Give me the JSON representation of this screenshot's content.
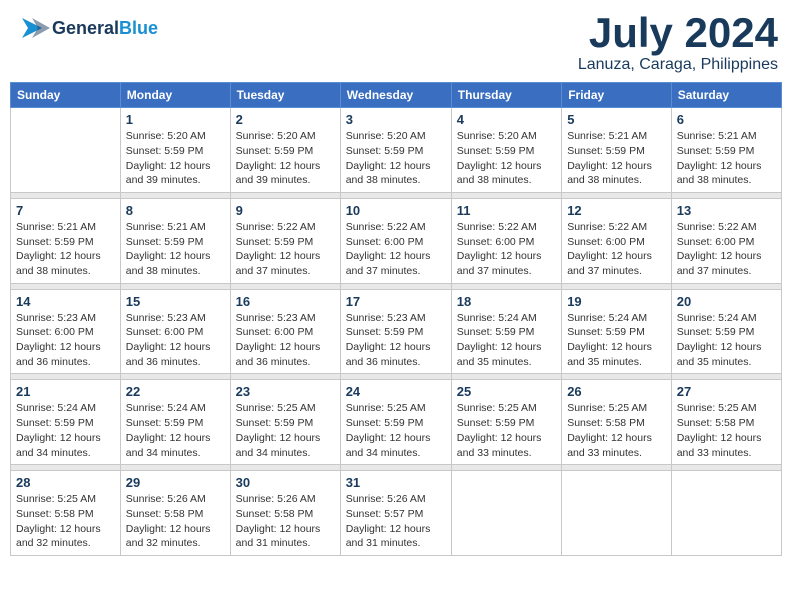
{
  "header": {
    "logo_general": "General",
    "logo_blue": "Blue",
    "month": "July 2024",
    "location": "Lanuza, Caraga, Philippines"
  },
  "days_of_week": [
    "Sunday",
    "Monday",
    "Tuesday",
    "Wednesday",
    "Thursday",
    "Friday",
    "Saturday"
  ],
  "weeks": [
    {
      "days": [
        {
          "num": "",
          "sunrise": "",
          "sunset": "",
          "daylight": ""
        },
        {
          "num": "1",
          "sunrise": "Sunrise: 5:20 AM",
          "sunset": "Sunset: 5:59 PM",
          "daylight": "Daylight: 12 hours and 39 minutes."
        },
        {
          "num": "2",
          "sunrise": "Sunrise: 5:20 AM",
          "sunset": "Sunset: 5:59 PM",
          "daylight": "Daylight: 12 hours and 39 minutes."
        },
        {
          "num": "3",
          "sunrise": "Sunrise: 5:20 AM",
          "sunset": "Sunset: 5:59 PM",
          "daylight": "Daylight: 12 hours and 38 minutes."
        },
        {
          "num": "4",
          "sunrise": "Sunrise: 5:20 AM",
          "sunset": "Sunset: 5:59 PM",
          "daylight": "Daylight: 12 hours and 38 minutes."
        },
        {
          "num": "5",
          "sunrise": "Sunrise: 5:21 AM",
          "sunset": "Sunset: 5:59 PM",
          "daylight": "Daylight: 12 hours and 38 minutes."
        },
        {
          "num": "6",
          "sunrise": "Sunrise: 5:21 AM",
          "sunset": "Sunset: 5:59 PM",
          "daylight": "Daylight: 12 hours and 38 minutes."
        }
      ]
    },
    {
      "days": [
        {
          "num": "7",
          "sunrise": "Sunrise: 5:21 AM",
          "sunset": "Sunset: 5:59 PM",
          "daylight": "Daylight: 12 hours and 38 minutes."
        },
        {
          "num": "8",
          "sunrise": "Sunrise: 5:21 AM",
          "sunset": "Sunset: 5:59 PM",
          "daylight": "Daylight: 12 hours and 38 minutes."
        },
        {
          "num": "9",
          "sunrise": "Sunrise: 5:22 AM",
          "sunset": "Sunset: 5:59 PM",
          "daylight": "Daylight: 12 hours and 37 minutes."
        },
        {
          "num": "10",
          "sunrise": "Sunrise: 5:22 AM",
          "sunset": "Sunset: 6:00 PM",
          "daylight": "Daylight: 12 hours and 37 minutes."
        },
        {
          "num": "11",
          "sunrise": "Sunrise: 5:22 AM",
          "sunset": "Sunset: 6:00 PM",
          "daylight": "Daylight: 12 hours and 37 minutes."
        },
        {
          "num": "12",
          "sunrise": "Sunrise: 5:22 AM",
          "sunset": "Sunset: 6:00 PM",
          "daylight": "Daylight: 12 hours and 37 minutes."
        },
        {
          "num": "13",
          "sunrise": "Sunrise: 5:22 AM",
          "sunset": "Sunset: 6:00 PM",
          "daylight": "Daylight: 12 hours and 37 minutes."
        }
      ]
    },
    {
      "days": [
        {
          "num": "14",
          "sunrise": "Sunrise: 5:23 AM",
          "sunset": "Sunset: 6:00 PM",
          "daylight": "Daylight: 12 hours and 36 minutes."
        },
        {
          "num": "15",
          "sunrise": "Sunrise: 5:23 AM",
          "sunset": "Sunset: 6:00 PM",
          "daylight": "Daylight: 12 hours and 36 minutes."
        },
        {
          "num": "16",
          "sunrise": "Sunrise: 5:23 AM",
          "sunset": "Sunset: 6:00 PM",
          "daylight": "Daylight: 12 hours and 36 minutes."
        },
        {
          "num": "17",
          "sunrise": "Sunrise: 5:23 AM",
          "sunset": "Sunset: 5:59 PM",
          "daylight": "Daylight: 12 hours and 36 minutes."
        },
        {
          "num": "18",
          "sunrise": "Sunrise: 5:24 AM",
          "sunset": "Sunset: 5:59 PM",
          "daylight": "Daylight: 12 hours and 35 minutes."
        },
        {
          "num": "19",
          "sunrise": "Sunrise: 5:24 AM",
          "sunset": "Sunset: 5:59 PM",
          "daylight": "Daylight: 12 hours and 35 minutes."
        },
        {
          "num": "20",
          "sunrise": "Sunrise: 5:24 AM",
          "sunset": "Sunset: 5:59 PM",
          "daylight": "Daylight: 12 hours and 35 minutes."
        }
      ]
    },
    {
      "days": [
        {
          "num": "21",
          "sunrise": "Sunrise: 5:24 AM",
          "sunset": "Sunset: 5:59 PM",
          "daylight": "Daylight: 12 hours and 34 minutes."
        },
        {
          "num": "22",
          "sunrise": "Sunrise: 5:24 AM",
          "sunset": "Sunset: 5:59 PM",
          "daylight": "Daylight: 12 hours and 34 minutes."
        },
        {
          "num": "23",
          "sunrise": "Sunrise: 5:25 AM",
          "sunset": "Sunset: 5:59 PM",
          "daylight": "Daylight: 12 hours and 34 minutes."
        },
        {
          "num": "24",
          "sunrise": "Sunrise: 5:25 AM",
          "sunset": "Sunset: 5:59 PM",
          "daylight": "Daylight: 12 hours and 34 minutes."
        },
        {
          "num": "25",
          "sunrise": "Sunrise: 5:25 AM",
          "sunset": "Sunset: 5:59 PM",
          "daylight": "Daylight: 12 hours and 33 minutes."
        },
        {
          "num": "26",
          "sunrise": "Sunrise: 5:25 AM",
          "sunset": "Sunset: 5:58 PM",
          "daylight": "Daylight: 12 hours and 33 minutes."
        },
        {
          "num": "27",
          "sunrise": "Sunrise: 5:25 AM",
          "sunset": "Sunset: 5:58 PM",
          "daylight": "Daylight: 12 hours and 33 minutes."
        }
      ]
    },
    {
      "days": [
        {
          "num": "28",
          "sunrise": "Sunrise: 5:25 AM",
          "sunset": "Sunset: 5:58 PM",
          "daylight": "Daylight: 12 hours and 32 minutes."
        },
        {
          "num": "29",
          "sunrise": "Sunrise: 5:26 AM",
          "sunset": "Sunset: 5:58 PM",
          "daylight": "Daylight: 12 hours and 32 minutes."
        },
        {
          "num": "30",
          "sunrise": "Sunrise: 5:26 AM",
          "sunset": "Sunset: 5:58 PM",
          "daylight": "Daylight: 12 hours and 31 minutes."
        },
        {
          "num": "31",
          "sunrise": "Sunrise: 5:26 AM",
          "sunset": "Sunset: 5:57 PM",
          "daylight": "Daylight: 12 hours and 31 minutes."
        },
        {
          "num": "",
          "sunrise": "",
          "sunset": "",
          "daylight": ""
        },
        {
          "num": "",
          "sunrise": "",
          "sunset": "",
          "daylight": ""
        },
        {
          "num": "",
          "sunrise": "",
          "sunset": "",
          "daylight": ""
        }
      ]
    }
  ]
}
